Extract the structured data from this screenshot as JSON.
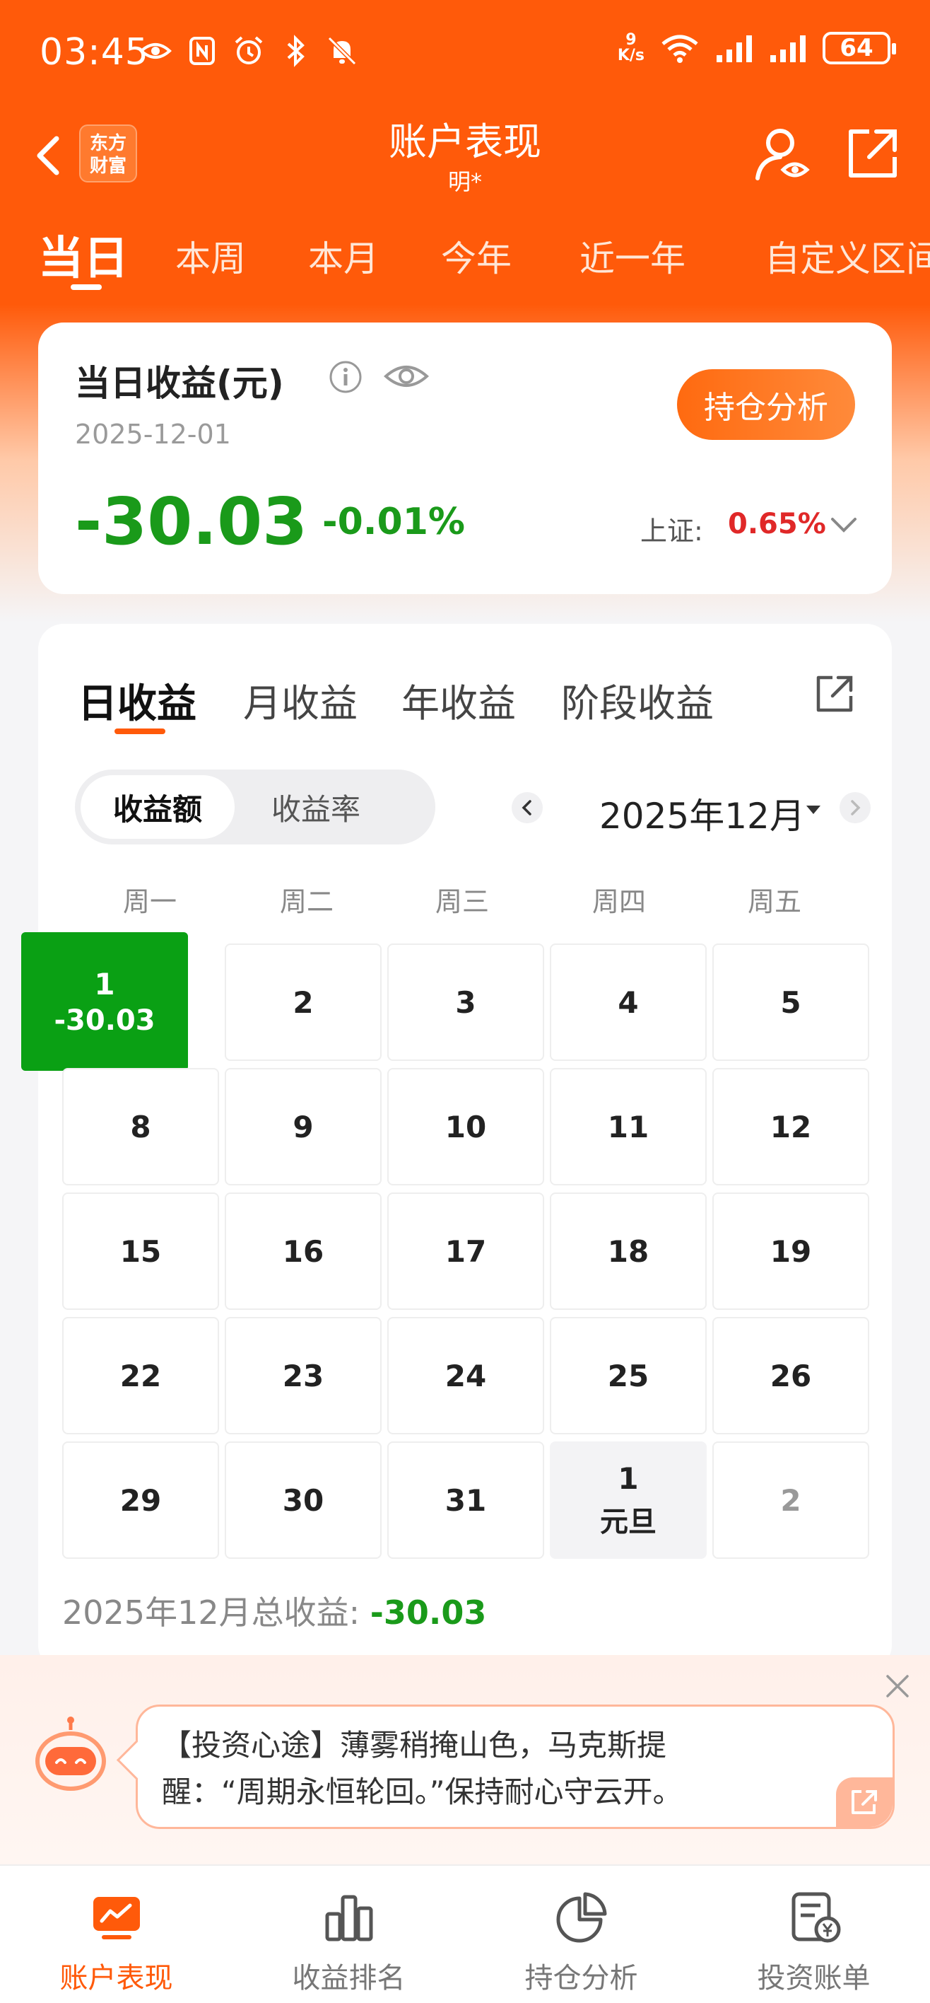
{
  "status_bar": {
    "time": "03:45",
    "net_speed_value": "9",
    "net_speed_unit": "K/s",
    "battery": "64"
  },
  "header": {
    "brand_logo_text": "东方\n财富",
    "title": "账户表现",
    "subtitle": "明*"
  },
  "period_tabs": [
    "当日",
    "本周",
    "本月",
    "今年",
    "近一年",
    "自定义区间"
  ],
  "summary": {
    "title": "当日收益(元)",
    "date": "2025-12-01",
    "amount": "-30.03",
    "percent": "-0.01%",
    "holding_button": "持仓分析",
    "index_label": "上证:",
    "index_value": "0.65%"
  },
  "calendar": {
    "revenue_tabs": [
      "日收益",
      "月收益",
      "年收益",
      "阶段收益"
    ],
    "segment": [
      "收益额",
      "收益率"
    ],
    "month_label": "2025年12月",
    "weekdays": [
      "周一",
      "周二",
      "周三",
      "周四",
      "周五"
    ],
    "rows": [
      [
        {
          "day": "1",
          "sub": "-30.03"
        },
        {
          "day": "2"
        },
        {
          "day": "3"
        },
        {
          "day": "4"
        },
        {
          "day": "5"
        }
      ],
      [
        {
          "day": "8"
        },
        {
          "day": "9"
        },
        {
          "day": "10"
        },
        {
          "day": "11"
        },
        {
          "day": "12"
        }
      ],
      [
        {
          "day": "15"
        },
        {
          "day": "16"
        },
        {
          "day": "17"
        },
        {
          "day": "18"
        },
        {
          "day": "19"
        }
      ],
      [
        {
          "day": "22"
        },
        {
          "day": "23"
        },
        {
          "day": "24"
        },
        {
          "day": "25"
        },
        {
          "day": "26"
        }
      ],
      [
        {
          "day": "29"
        },
        {
          "day": "30"
        },
        {
          "day": "31"
        },
        {
          "day": "1",
          "sub": "元旦"
        },
        {
          "day": "2"
        }
      ]
    ],
    "month_total_label": "2025年12月总收益: ",
    "month_total_value": "-30.03"
  },
  "tip": {
    "line1": "【投资心途】薄雾稍掩山色，马克斯提",
    "line2": "醒：“周期永恒轮回。”保持耐心守云开。"
  },
  "bottom_nav": [
    {
      "label": "账户表现",
      "icon": "account-performance-icon"
    },
    {
      "label": "收益排名",
      "icon": "bar-chart-icon"
    },
    {
      "label": "持仓分析",
      "icon": "pie-chart-icon"
    },
    {
      "label": "投资账单",
      "icon": "bill-icon"
    }
  ],
  "colors": {
    "brand_orange": "#ff5a0a",
    "loss_green": "#1a9a1a",
    "gain_red": "#e02828"
  }
}
